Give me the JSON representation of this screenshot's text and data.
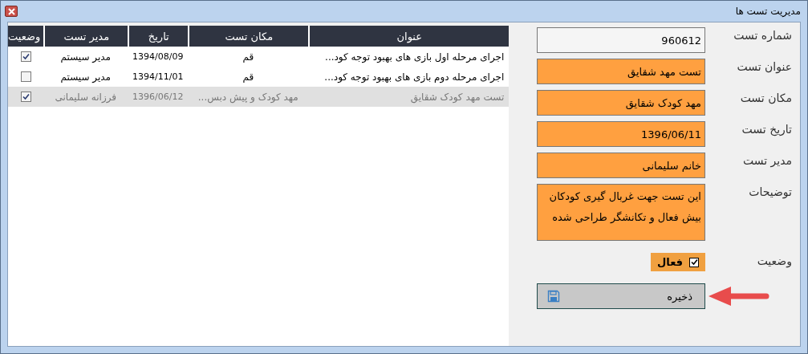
{
  "window": {
    "title": "مدیریت تست ها"
  },
  "table": {
    "columns": [
      "عنوان",
      "مکان تست",
      "تاریخ",
      "مدیر تست",
      "وضعیت"
    ],
    "rows": [
      {
        "title": "اجرای مرحله اول بازی های بهبود توجه کود...",
        "place": "قم",
        "date": "1394/08/09",
        "manager": "مدیر سیستم",
        "active": true,
        "selected": false
      },
      {
        "title": "اجرای مرحله دوم بازی های بهبود توجه کود...",
        "place": "قم",
        "date": "1394/11/01",
        "manager": "مدیر سیستم",
        "active": false,
        "selected": false
      },
      {
        "title": "تست مهد کودک شقایق",
        "place": "مهد کودک و پیش دبس...",
        "date": "1396/06/12",
        "manager": "فرزانه سلیمانی",
        "active": true,
        "selected": true
      }
    ]
  },
  "form": {
    "fields": [
      {
        "label": "شماره تست",
        "value": "960612",
        "kind": "text",
        "highlighted": false
      },
      {
        "label": "عنوان تست",
        "value": "تست مهد شقایق",
        "kind": "text",
        "highlighted": true
      },
      {
        "label": "مکان تست",
        "value": "مهد کودک شقایق",
        "kind": "text",
        "highlighted": true
      },
      {
        "label": "تاریخ تست",
        "value": "1396/06/11",
        "kind": "text",
        "highlighted": true
      },
      {
        "label": "مدیر تست",
        "value": "خانم سلیمانی",
        "kind": "text",
        "highlighted": true
      },
      {
        "label": "توضیحات",
        "value": "این تست جهت غربال گیری کودکان بیش فعال و تکانشگر طراحی شده",
        "kind": "multiline",
        "highlighted": true
      }
    ],
    "status": {
      "label": "وضعیت",
      "option": "فعال",
      "checked": true
    },
    "save_button": "ذخیره"
  }
}
